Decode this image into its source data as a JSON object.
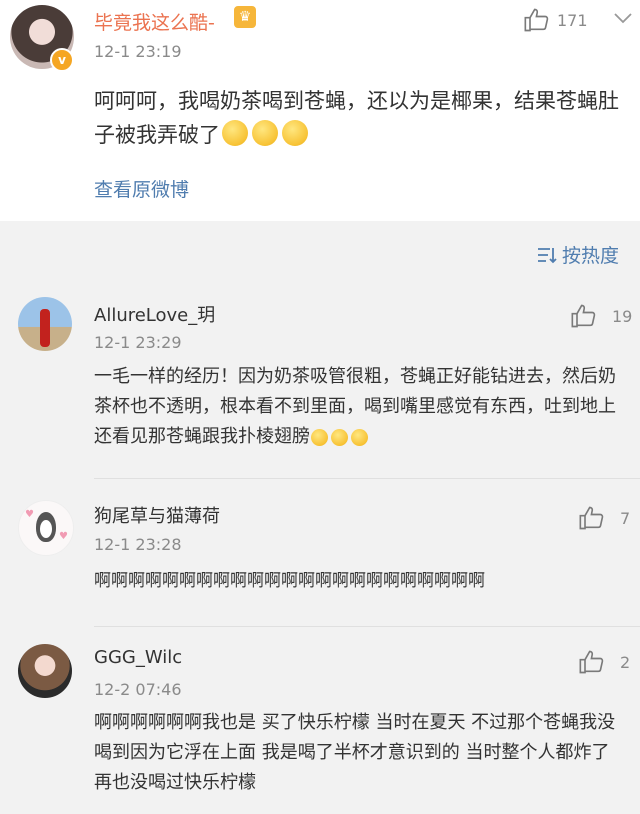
{
  "post": {
    "username": "毕竟我这么酷-",
    "badge_icon": "crown-icon",
    "time": "12-1 23:19",
    "likes": "171",
    "text": "呵呵呵，我喝奶茶喝到苍蝇，还以为是椰果，结果苍蝇肚子被我弄破了",
    "view_original": "查看原微博"
  },
  "sort": {
    "label": "按热度"
  },
  "comments": [
    {
      "name": "AllureLove_玥",
      "time": "12-1 23:29",
      "likes": "19",
      "text": "一毛一样的经历！因为奶茶吸管很粗，苍蝇正好能钻进去，然后奶茶杯也不透明，根本看不到里面，喝到嘴里感觉有东西，吐到地上还看见那苍蝇跟我扑棱翅膀"
    },
    {
      "name": "狗尾草与猫薄荷",
      "time": "12-1 23:28",
      "likes": "7",
      "text": "啊啊啊啊啊啊啊啊啊啊啊啊啊啊啊啊啊啊啊啊啊啊啊"
    },
    {
      "name": "GGG_Wilc",
      "time": "12-2 07:46",
      "likes": "2",
      "text": "啊啊啊啊啊啊我也是 买了快乐柠檬 当时在夏天 不过那个苍蝇我没喝到因为它浮在上面 我是喝了半杯才意识到的 当时整个人都炸了 再也没喝过快乐柠檬"
    }
  ],
  "colors": {
    "name_orange": "#eb7350",
    "link_blue": "#507daf",
    "gray": "#8a8a8a"
  }
}
